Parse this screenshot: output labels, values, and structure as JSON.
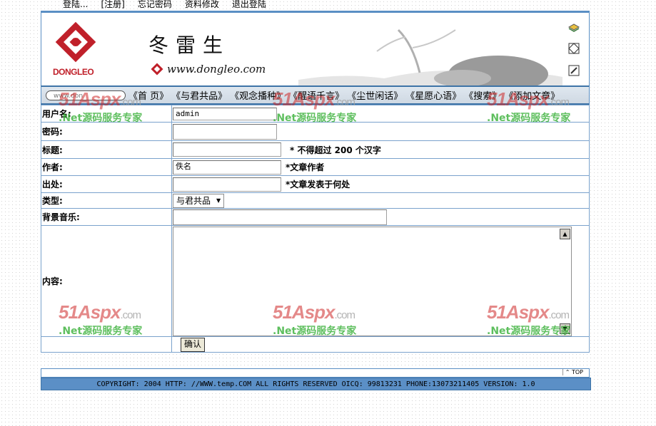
{
  "top_links": [
    "登陆...",
    "[注册]",
    "忘记密码",
    "资料修改",
    "退出登陆"
  ],
  "header": {
    "brand_latin": "DONGLEO",
    "brand_cn": "冬雷生",
    "url": "www.dongleo.com",
    "side_icons": [
      "book-icon",
      "map-icon",
      "edit-icon"
    ]
  },
  "nav": {
    "search_hint": "www.don",
    "items": [
      "《首 页》",
      "《与君共品》",
      "《观念播种》",
      "《醒语千言》",
      "《尘世闲话》",
      "《星愿心语》",
      "《搜索》",
      "《添加文章》"
    ]
  },
  "form": {
    "username_label": "用户名:",
    "username_value": "admin",
    "password_label": "密码:",
    "title_label": "标题:",
    "title_note": "* 不得超过 200 个汉字",
    "author_label": "作者:",
    "author_value": "佚名",
    "author_note": "*文章作者",
    "source_label": "出处:",
    "source_note": "*文章发表于何处",
    "type_label": "类型:",
    "type_value": "与君共品",
    "music_label": "背景音乐:",
    "content_label": "内容:",
    "submit_label": "确认"
  },
  "footer": {
    "top_label": "TOP",
    "copyright": "COPYRIGHT: 2004 HTTP: //WWW.temp.COM ALL RIGHTS RESERVED OICQ: 99813231 PHONE:13073211405 VERSION: 1.0"
  },
  "watermark": {
    "big": "51Aspx",
    "suffix": ".com",
    "small": ".Net源码服务专家"
  },
  "colors": {
    "frame_blue": "#5a8fc4",
    "footer_blue": "#5b8fc6",
    "brand_red": "#c0202a"
  }
}
